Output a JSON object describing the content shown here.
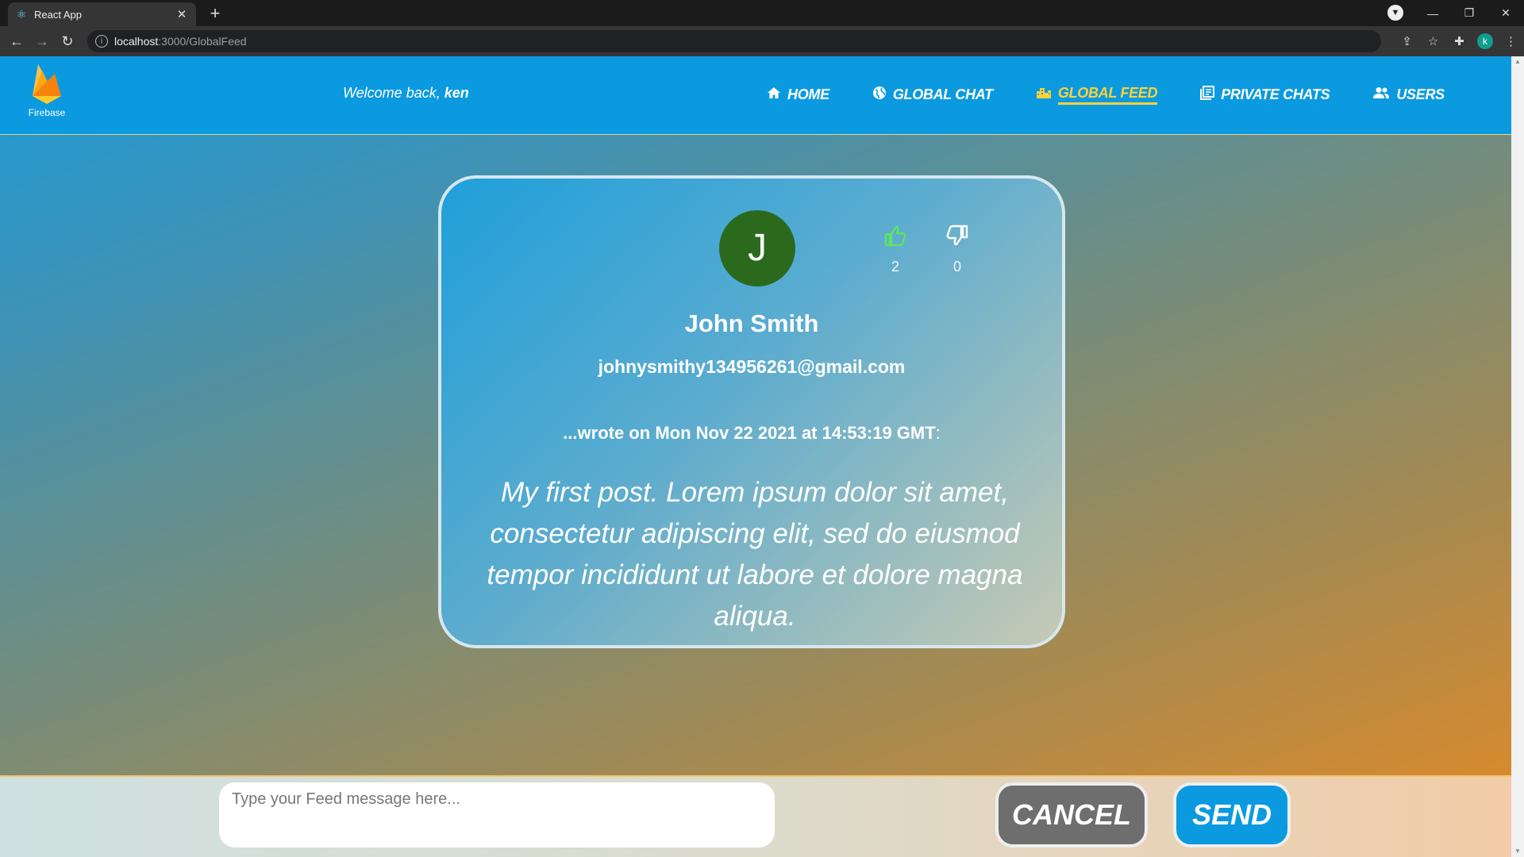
{
  "browser": {
    "tab_title": "React App",
    "url_host": "localhost",
    "url_path": ":3000/GlobalFeed",
    "profile_initial": "k"
  },
  "app": {
    "logo_label": "Firebase",
    "welcome_prefix": "Welcome back,",
    "username": "ken",
    "nav": [
      {
        "label": "HOME",
        "icon": "home-icon",
        "active": false
      },
      {
        "label": "GLOBAL CHAT",
        "icon": "globe-icon",
        "active": false
      },
      {
        "label": "GLOBAL FEED",
        "icon": "city-icon",
        "active": true
      },
      {
        "label": "PRIVATE CHATS",
        "icon": "chats-icon",
        "active": false
      },
      {
        "label": "USERS",
        "icon": "users-icon",
        "active": false
      }
    ],
    "colors": {
      "nav_bg": "#0b9ae0",
      "active": "#ffd23a",
      "like": "#5ce65c",
      "avatar": "#2b6a1c"
    }
  },
  "post": {
    "avatar_initial": "J",
    "likes": "2",
    "dislikes": "0",
    "author": "John Smith",
    "email": "johnysmithy134956261@gmail.com",
    "wrote_prefix": "...wrote on",
    "date": "Mon Nov 22 2021 at 14:53:19 GMT",
    "wrote_suffix": ":",
    "message": "My first post. Lorem ipsum dolor sit amet, consectetur adipiscing elit, sed do eiusmod tempor incididunt ut labore et dolore magna aliqua."
  },
  "composer": {
    "placeholder": "Type your Feed message here...",
    "cancel_label": "CANCEL",
    "send_label": "SEND"
  }
}
